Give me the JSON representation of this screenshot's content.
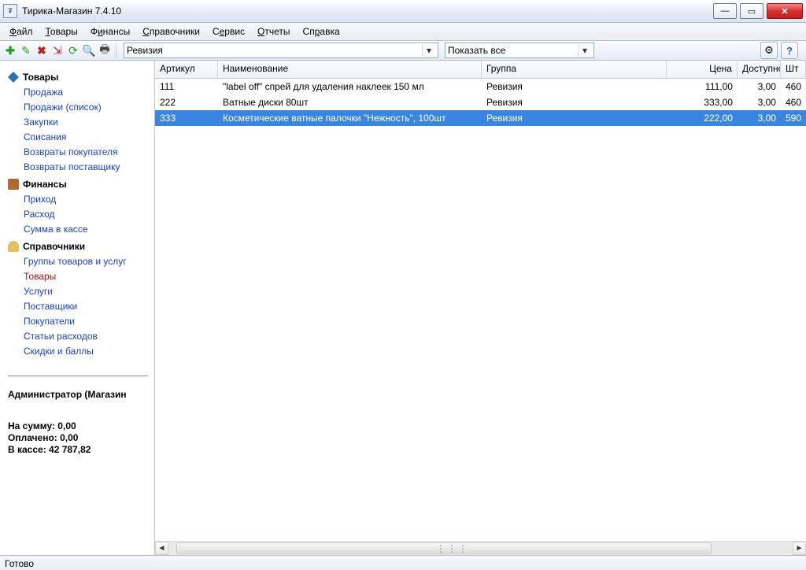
{
  "window": {
    "title": "Тирика-Магазин 7.4.10"
  },
  "menu": [
    "Файл",
    "Товары",
    "Финансы",
    "Справочники",
    "Сервис",
    "Отчеты",
    "Справка"
  ],
  "toolbar": {
    "combo_view": "Ревизия",
    "combo_filter": "Показать все"
  },
  "sidebar": {
    "sections": [
      {
        "title": "Товары",
        "links": [
          "Продажа",
          "Продажи (список)",
          "Закупки",
          "Списания",
          "Возвраты покупателя",
          "Возвраты поставщику"
        ]
      },
      {
        "title": "Финансы",
        "links": [
          "Приход",
          "Расход",
          "Сумма в кассе"
        ]
      },
      {
        "title": "Справочники",
        "links": [
          "Группы товаров и услуг",
          "Товары",
          "Услуги",
          "Поставщики",
          "Покупатели",
          "Статьи расходов",
          "Скидки и баллы"
        ]
      }
    ],
    "admin_label": "Администратор (Магазин",
    "sum_line": "На сумму: 0,00",
    "paid_line": "Оплачено: 0,00",
    "cash_line": "В кассе: 42 787,82"
  },
  "columns": {
    "art": "Артикул",
    "name": "Наименование",
    "group": "Группа",
    "price": "Цена",
    "avail": "Доступно",
    "unit": "Шт"
  },
  "rows": [
    {
      "art": "111",
      "name": "\"label off\" спрей для удаления наклеек 150 мл",
      "group": "Ревизия",
      "price": "111,00",
      "avail": "3,00",
      "unit": "460"
    },
    {
      "art": "222",
      "name": "Ватные диски 80шт",
      "group": "Ревизия",
      "price": "333,00",
      "avail": "3,00",
      "unit": "460"
    },
    {
      "art": "333",
      "name": "Косметические ватные палочки \"Нежность\", 100шт",
      "group": "Ревизия",
      "price": "222,00",
      "avail": "3,00",
      "unit": "590"
    }
  ],
  "status": "Готово"
}
